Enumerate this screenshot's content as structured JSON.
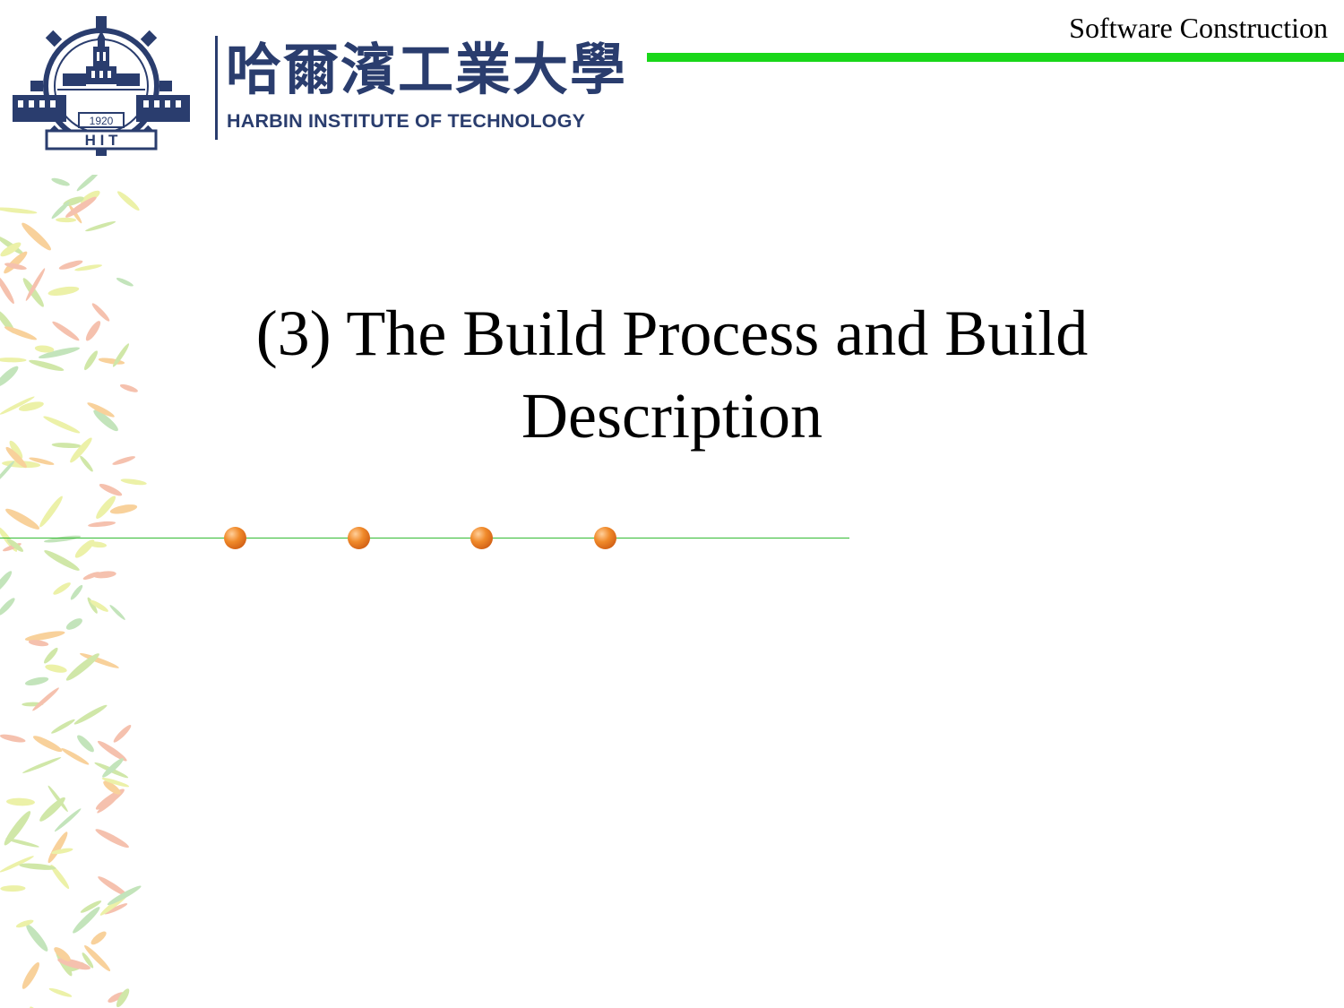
{
  "header": {
    "university_name_cn": "哈爾濱工業大學",
    "university_name_en": "HARBIN INSTITUTE OF TECHNOLOGY",
    "emblem_year": "1920",
    "emblem_initials": "H I T",
    "course_label": "Software Construction",
    "rule_color": "#19d719"
  },
  "slide": {
    "title_line1": "(3) The Build Process and Build",
    "title_line2": "Description"
  },
  "decor": {
    "bullet_dots": 4,
    "dot_color": "#e8731e",
    "divider_color": "#33bb33"
  }
}
